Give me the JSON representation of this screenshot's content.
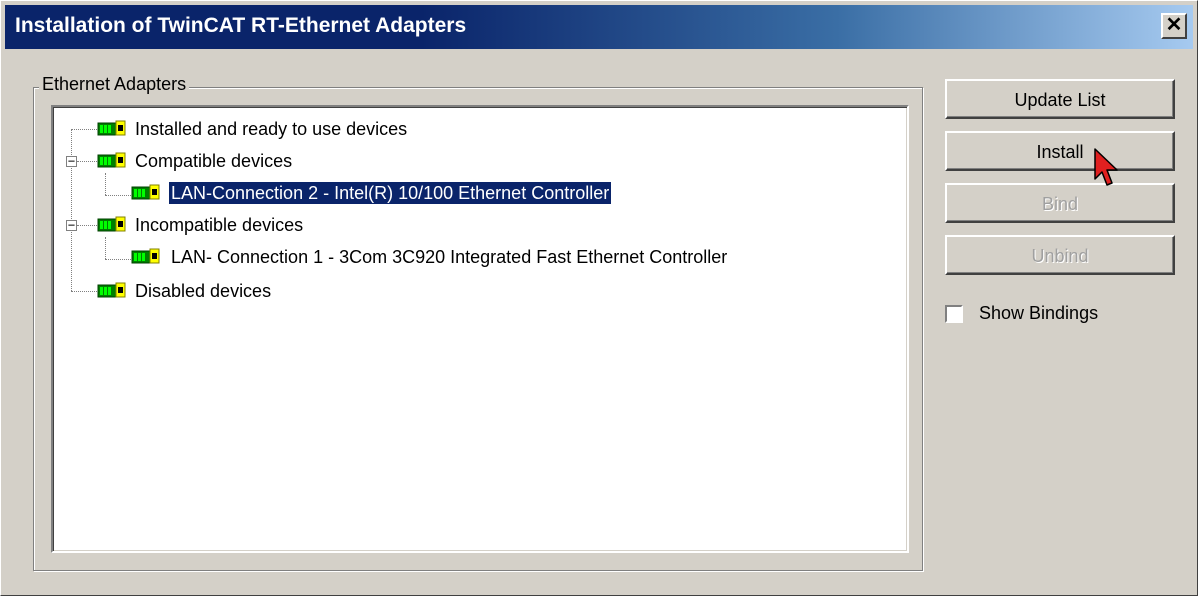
{
  "window": {
    "title": "Installation of TwinCAT RT-Ethernet Adapters",
    "close_label": "✕"
  },
  "group": {
    "label": "Ethernet Adapters"
  },
  "tree": {
    "nodes": [
      {
        "label": "Installed and ready to use devices",
        "level": 0,
        "expandable": false
      },
      {
        "label": "Compatible devices",
        "level": 0,
        "expandable": true,
        "expanded": true
      },
      {
        "label": "LAN-Connection 2 - Intel(R) 10/100 Ethernet Controller",
        "level": 1,
        "selected": true
      },
      {
        "label": "Incompatible devices",
        "level": 0,
        "expandable": true,
        "expanded": true
      },
      {
        "label": "LAN- Connection 1 - 3Com 3C920 Integrated Fast Ethernet Controller",
        "level": 1
      },
      {
        "label": "Disabled devices",
        "level": 0,
        "expandable": false
      }
    ],
    "expander_minus": "−",
    "node_icon": "network-card-icon"
  },
  "buttons": {
    "update_list": "Update List",
    "install": "Install",
    "bind": "Bind",
    "unbind": "Unbind"
  },
  "show_bindings": {
    "label": "Show Bindings",
    "checked": false
  },
  "colors": {
    "titlebar": "#0a246a",
    "selection": "#0a246a",
    "face": "#d4d0c8",
    "cursor": "#e02020"
  }
}
